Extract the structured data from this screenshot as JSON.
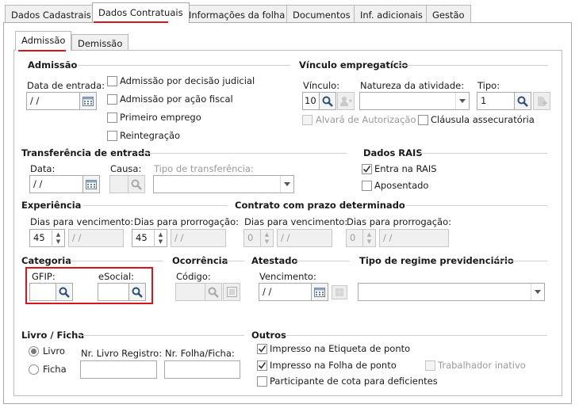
{
  "tabs": [
    "Dados Cadastrais",
    "Dados Contratuais",
    "Informações da folha",
    "Documentos",
    "Inf. adicionais",
    "Gestão"
  ],
  "subtabs": [
    "Admissão",
    "Demissão"
  ],
  "admissao": {
    "title": "Admissão",
    "data_label": "Data de entrada:",
    "data_value": " /  /",
    "checks": [
      "Admissão por decisão judicial",
      "Admissão por ação fiscal",
      "Primeiro emprego",
      "Reintegração"
    ]
  },
  "vinculo": {
    "title": "Vínculo empregatício",
    "vinculo_label": "Vínculo:",
    "vinculo_value": "10",
    "natureza_label": "Natureza da atividade:",
    "tipo_label": "Tipo:",
    "tipo_value": "1",
    "alvara": "Alvará de Autorização",
    "clausula": "Cláusula assecuratória"
  },
  "transferencia": {
    "title": "Transferência de entrada",
    "data_label": "Data:",
    "data_value": " /  /",
    "causa_label": "Causa:",
    "tipo_label": "Tipo de transferência:"
  },
  "rais": {
    "title": "Dados RAIS",
    "entra": "Entra na RAIS",
    "aposentado": "Aposentado"
  },
  "experiencia": {
    "title": "Experiência",
    "venc_label": "Dias para vencimento:",
    "venc_value": "45",
    "venc_date": " /  /",
    "prorr_label": "Dias para prorrogação:",
    "prorr_value": "45",
    "prorr_date": " /  /"
  },
  "contrato": {
    "title": "Contrato com prazo determinado",
    "venc_label": "Dias para vencimento:",
    "venc_value": "0",
    "venc_date": " /  /",
    "prorr_label": "Dias para prorrogação:",
    "prorr_value": "0",
    "prorr_date": " /  /"
  },
  "categoria": {
    "title": "Categoria",
    "gfip_label": "GFIP:",
    "esocial_label": "eSocial:"
  },
  "ocorrencia": {
    "title": "Ocorrência",
    "codigo_label": "Código:"
  },
  "atestado": {
    "title": "Atestado",
    "venc_label": "Vencimento:",
    "venc_value": " /  /"
  },
  "regime": {
    "title": "Tipo de regime previdenciário"
  },
  "livro": {
    "title": "Livro / Ficha",
    "livro": "Livro",
    "ficha": "Ficha",
    "nr_livro_label": "Nr. Livro Registro:",
    "nr_folha_label": "Nr. Folha/Ficha:"
  },
  "outros": {
    "title": "Outros",
    "etiqueta": "Impresso na Etiqueta de ponto",
    "folha": "Impresso na Folha de ponto",
    "inativo": "Trabalhador inativo",
    "cota": "Participante de cota para deficientes"
  },
  "colors": {
    "highlight": "#d8141c"
  }
}
